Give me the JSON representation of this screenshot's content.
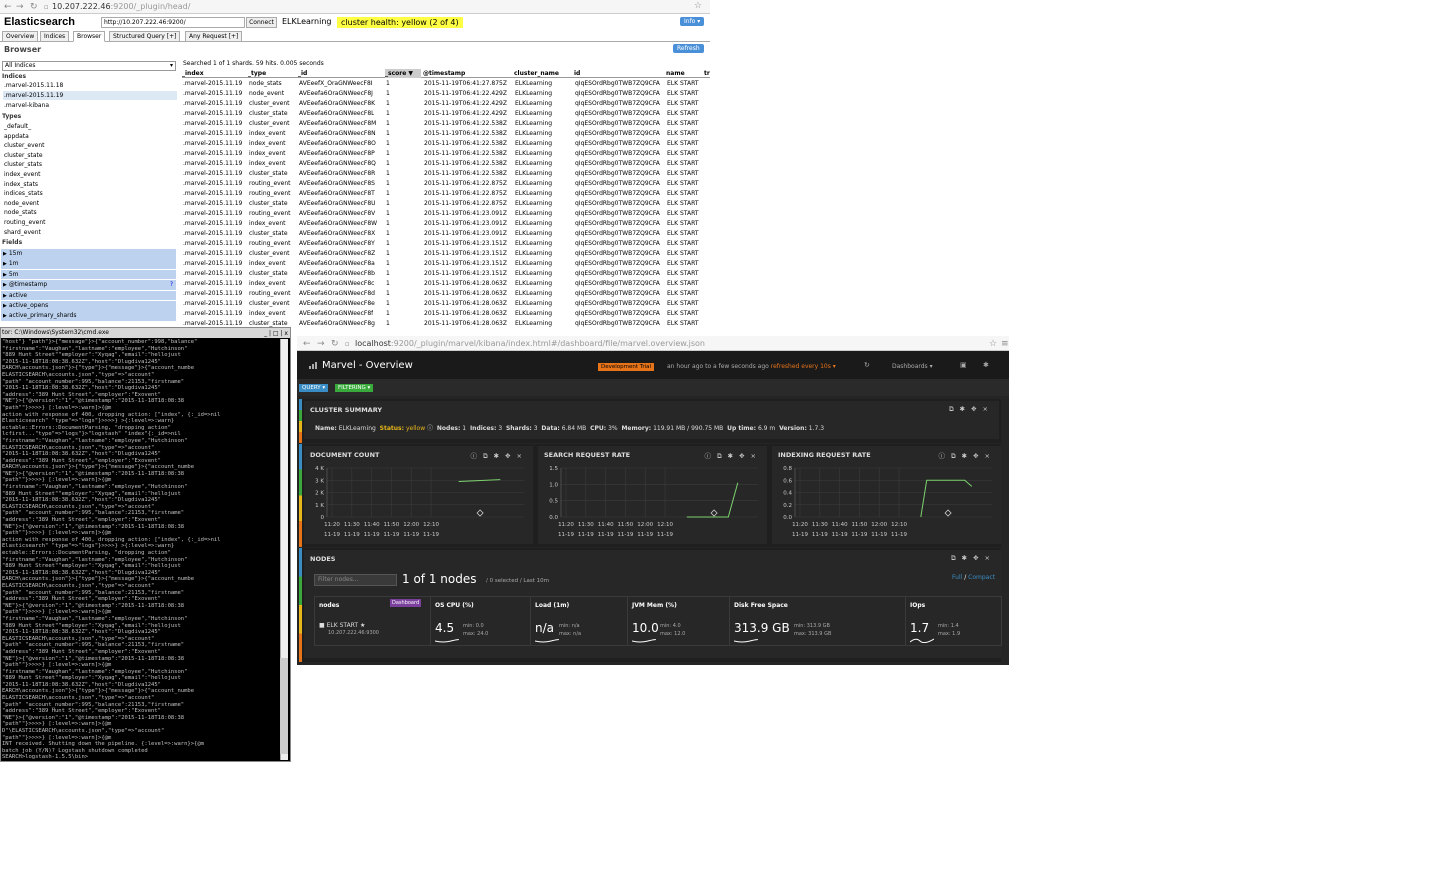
{
  "head_browser": {
    "url_host": "10.207.222.46",
    "url_rest": ":9200/_plugin/head/",
    "app_title": "Elasticsearch",
    "connect_url": "http://10.207.222.46:9200/",
    "connect_label": "Connect",
    "cluster_name": "ELKLearning",
    "cluster_health": "cluster health: yellow (2 of 4)",
    "info_label": "Info ▾",
    "tabs": [
      "Overview",
      "Indices",
      "Browser",
      "Structured Query [+]",
      "Any Request [+]"
    ],
    "section_title": "Browser",
    "refresh_label": "Refresh",
    "index_select": "All Indices",
    "indices_header": "Indices",
    "indices": [
      ".marvel-2015.11.18",
      ".marvel-2015.11.19",
      ".marvel-kibana"
    ],
    "types_header": "Types",
    "types": [
      "_default_",
      "appdata",
      "cluster_event",
      "cluster_state",
      "cluster_stats",
      "index_event",
      "index_stats",
      "indices_stats",
      "node_event",
      "node_stats",
      "routing_event",
      "shard_event"
    ],
    "fields_header": "Fields",
    "fields": [
      "15m",
      "1m",
      "5m",
      "@timestamp",
      "active",
      "active_opens",
      "active_primary_shards"
    ],
    "results_summary": "Searched 1 of 1 shards. 59 hits. 0.005 seconds",
    "columns": [
      "_index",
      "_type",
      "_id",
      "_score ▼",
      "@timestamp",
      "cluster_name",
      "id",
      "name",
      "tr"
    ],
    "rows": [
      [
        ".marvel-2015.11.19",
        "node_stats",
        "AVEeefX_OraGNWeecF8I",
        "1",
        "2015-11-19T06:41:27.875Z",
        "ELKLearning",
        "qIqESOrdRbg0TWB7ZQ9CFA",
        "ELK START"
      ],
      [
        ".marvel-2015.11.19",
        "node_event",
        "AVEeefa6OraGNWeecF8J",
        "1",
        "2015-11-19T06:41:22.429Z",
        "ELKLearning",
        "qIqESOrdRbg0TWB7ZQ9CFA",
        "ELK START"
      ],
      [
        ".marvel-2015.11.19",
        "cluster_event",
        "AVEeefa6OraGNWeecF8K",
        "1",
        "2015-11-19T06:41:22.429Z",
        "ELKLearning",
        "qIqESOrdRbg0TWB7ZQ9CFA",
        "ELK START"
      ],
      [
        ".marvel-2015.11.19",
        "cluster_state",
        "AVEeefa6OraGNWeecF8L",
        "1",
        "2015-11-19T06:41:22.429Z",
        "ELKLearning",
        "qIqESOrdRbg0TWB7ZQ9CFA",
        "ELK START"
      ],
      [
        ".marvel-2015.11.19",
        "cluster_event",
        "AVEeefa6OraGNWeecF8M",
        "1",
        "2015-11-19T06:41:22.538Z",
        "ELKLearning",
        "qIqESOrdRbg0TWB7ZQ9CFA",
        "ELK START"
      ],
      [
        ".marvel-2015.11.19",
        "index_event",
        "AVEeefa6OraGNWeecF8N",
        "1",
        "2015-11-19T06:41:22.538Z",
        "ELKLearning",
        "qIqESOrdRbg0TWB7ZQ9CFA",
        "ELK START"
      ],
      [
        ".marvel-2015.11.19",
        "index_event",
        "AVEeefa6OraGNWeecF8O",
        "1",
        "2015-11-19T06:41:22.538Z",
        "ELKLearning",
        "qIqESOrdRbg0TWB7ZQ9CFA",
        "ELK START"
      ],
      [
        ".marvel-2015.11.19",
        "index_event",
        "AVEeefa6OraGNWeecF8P",
        "1",
        "2015-11-19T06:41:22.538Z",
        "ELKLearning",
        "qIqESOrdRbg0TWB7ZQ9CFA",
        "ELK START"
      ],
      [
        ".marvel-2015.11.19",
        "index_event",
        "AVEeefa6OraGNWeecF8Q",
        "1",
        "2015-11-19T06:41:22.538Z",
        "ELKLearning",
        "qIqESOrdRbg0TWB7ZQ9CFA",
        "ELK START"
      ],
      [
        ".marvel-2015.11.19",
        "cluster_state",
        "AVEeefa6OraGNWeecF8R",
        "1",
        "2015-11-19T06:41:22.538Z",
        "ELKLearning",
        "qIqESOrdRbg0TWB7ZQ9CFA",
        "ELK START"
      ],
      [
        ".marvel-2015.11.19",
        "routing_event",
        "AVEeefa6OraGNWeecF8S",
        "1",
        "2015-11-19T06:41:22.875Z",
        "ELKLearning",
        "qIqESOrdRbg0TWB7ZQ9CFA",
        "ELK START"
      ],
      [
        ".marvel-2015.11.19",
        "routing_event",
        "AVEeefa6OraGNWeecF8T",
        "1",
        "2015-11-19T06:41:22.875Z",
        "ELKLearning",
        "qIqESOrdRbg0TWB7ZQ9CFA",
        "ELK START"
      ],
      [
        ".marvel-2015.11.19",
        "cluster_state",
        "AVEeefa6OraGNWeecF8U",
        "1",
        "2015-11-19T06:41:22.875Z",
        "ELKLearning",
        "qIqESOrdRbg0TWB7ZQ9CFA",
        "ELK START"
      ],
      [
        ".marvel-2015.11.19",
        "routing_event",
        "AVEeefa6OraGNWeecF8V",
        "1",
        "2015-11-19T06:41:23.091Z",
        "ELKLearning",
        "qIqESOrdRbg0TWB7ZQ9CFA",
        "ELK START"
      ],
      [
        ".marvel-2015.11.19",
        "index_event",
        "AVEeefa6OraGNWeecF8W",
        "1",
        "2015-11-19T06:41:23.091Z",
        "ELKLearning",
        "qIqESOrdRbg0TWB7ZQ9CFA",
        "ELK START"
      ],
      [
        ".marvel-2015.11.19",
        "cluster_state",
        "AVEeefa6OraGNWeecF8X",
        "1",
        "2015-11-19T06:41:23.091Z",
        "ELKLearning",
        "qIqESOrdRbg0TWB7ZQ9CFA",
        "ELK START"
      ],
      [
        ".marvel-2015.11.19",
        "routing_event",
        "AVEeefa6OraGNWeecF8Y",
        "1",
        "2015-11-19T06:41:23.151Z",
        "ELKLearning",
        "qIqESOrdRbg0TWB7ZQ9CFA",
        "ELK START"
      ],
      [
        ".marvel-2015.11.19",
        "cluster_event",
        "AVEeefa6OraGNWeecF8Z",
        "1",
        "2015-11-19T06:41:23.151Z",
        "ELKLearning",
        "qIqESOrdRbg0TWB7ZQ9CFA",
        "ELK START"
      ],
      [
        ".marvel-2015.11.19",
        "index_event",
        "AVEeefa6OraGNWeecF8a",
        "1",
        "2015-11-19T06:41:23.151Z",
        "ELKLearning",
        "qIqESOrdRbg0TWB7ZQ9CFA",
        "ELK START"
      ],
      [
        ".marvel-2015.11.19",
        "cluster_state",
        "AVEeefa6OraGNWeecF8b",
        "1",
        "2015-11-19T06:41:23.151Z",
        "ELKLearning",
        "qIqESOrdRbg0TWB7ZQ9CFA",
        "ELK START"
      ],
      [
        ".marvel-2015.11.19",
        "index_event",
        "AVEeefa6OraGNWeecF8c",
        "1",
        "2015-11-19T06:41:28.063Z",
        "ELKLearning",
        "qIqESOrdRbg0TWB7ZQ9CFA",
        "ELK START"
      ],
      [
        ".marvel-2015.11.19",
        "routing_event",
        "AVEeefa6OraGNWeecF8d",
        "1",
        "2015-11-19T06:41:28.063Z",
        "ELKLearning",
        "qIqESOrdRbg0TWB7ZQ9CFA",
        "ELK START"
      ],
      [
        ".marvel-2015.11.19",
        "cluster_event",
        "AVEeefa6OraGNWeecF8e",
        "1",
        "2015-11-19T06:41:28.063Z",
        "ELKLearning",
        "qIqESOrdRbg0TWB7ZQ9CFA",
        "ELK START"
      ],
      [
        ".marvel-2015.11.19",
        "index_event",
        "AVEeefa6OraGNWeecF8f",
        "1",
        "2015-11-19T06:41:28.063Z",
        "ELKLearning",
        "qIqESOrdRbg0TWB7ZQ9CFA",
        "ELK START"
      ],
      [
        ".marvel-2015.11.19",
        "cluster_state",
        "AVEeefa6OraGNWeecF8g",
        "1",
        "2015-11-19T06:41:28.063Z",
        "ELKLearning",
        "qIqESOrdRbg0TWB7ZQ9CFA",
        "ELK START"
      ]
    ]
  },
  "cmd": {
    "title": "tor: C:\\Windows\\System32\\cmd.exe",
    "buttons": "_ | □ | x",
    "lines": [
      "\"host\"} \"path\"}>{\"message\"}>{\"account_number\":998,\"balance\"",
      "\"firstname\":\"Vaughan\",\"lastname\":\"employee\",\"Hutchinson\"",
      "\"889 Hunt Street\"\"employer\":\"Xyqag\",\"email\":\"hellojust",
      "\"2015-11-18T18:08:38.632Z\",\"host\":\"Dlugdiva1245\"",
      "EARCH\\accounts.json\"}>{\"type\"}>{\"message\"}>{\"account_numbe",
      "ELASTICSEARCH\\accounts.json\",\"type\"=>\"account\"",
      "\"path\" \"account_number\":995,\"balance\":21153,\"firstname\"",
      "\"2015-11-18T18:08:38.632Z\",\"host\":\"Dlugdiva1245\"",
      "\"address\":\"389 Hunt Street\",\"employer\":\"Exovent\"",
      "\"NE\"}>{\"@version\":\"1\",\"@timestamp\":\"2015-11-18T18:08:38",
      "\"path\"\"}>>>>} [:level=>:warn]>{@m",
      "",
      "action with response of 400, dropping action: [\"index\", {:_id=>nil",
      "Elasticsearch\" \"type\"=>\"logs\"}>>>>} >{:level=>:warn}",
      "ectable::Errors::DocumentParsing, \"dropping action\"",
      "lcfirst...\"type\"=>\"logs\"}>\"logstash\" \"index\"{:_id=>nil",
      "\"firstname\":\"Vaughan\",\"lastname\":\"employee\",\"Hutchinson\"",
      "ELASTICSEARCH\\accounts.json\",\"type\"=>\"account\"",
      "\"2015-11-18T18:08:38.632Z\",\"host\":\"Dlugdiva1245\"",
      "\"address\":\"389 Hunt Street\",\"employer\":\"Exovent\"",
      "EARCH\\accounts.json\"}>{\"type\"}>{\"message\"}>{\"account_numbe",
      "\"NE\"}>{\"@version\":\"1\",\"@timestamp\":\"2015-11-18T18:08:38",
      "\"path\"\"}>>>>} [:level=>:warn]>{@m",
      "\"firstname\":\"Vaughan\",\"lastname\":\"employee\",\"Hutchinson\"",
      "\"889 Hunt Street\"\"employer\":\"Xyqag\",\"email\":\"hellojust",
      "\"2015-11-18T18:08:38.632Z\",\"host\":\"Dlugdiva1245\"",
      "ELASTICSEARCH\\accounts.json\",\"type\"=>\"account\"",
      "\"path\" \"account_number\":995,\"balance\":21153,\"firstname\"",
      "\"address\":\"389 Hunt Street\",\"employer\":\"Exovent\"",
      "\"NE\"}>{\"@version\":\"1\",\"@timestamp\":\"2015-11-18T18:08:38",
      "\"path\"\"}>>>>} [:level=>:warn]>{@m",
      "action with response of 400, dropping action: [\"index\", {:_id=>nil",
      "Elasticsearch\" \"type\"=>\"logs\"}>>>>} >{:level=>:warn}",
      "ectable::Errors::DocumentParsing, \"dropping action\"",
      "\"firstname\":\"Vaughan\",\"lastname\":\"employee\",\"Hutchinson\"",
      "\"889 Hunt Street\"\"employer\":\"Xyqag\",\"email\":\"hellojust",
      "\"2015-11-18T18:08:38.632Z\",\"host\":\"Dlugdiva1245\"",
      "EARCH\\accounts.json\"}>{\"type\"}>{\"message\"}>{\"account_numbe",
      "ELASTICSEARCH\\accounts.json\",\"type\"=>\"account\"",
      "\"path\" \"account_number\":995,\"balance\":21153,\"firstname\"",
      "\"address\":\"389 Hunt Street\",\"employer\":\"Exovent\"",
      "\"NE\"}>{\"@version\":\"1\",\"@timestamp\":\"2015-11-18T18:08:38",
      "\"path\"\"}>>>>} [:level=>:warn]>{@m",
      "\"firstname\":\"Vaughan\",\"lastname\":\"employee\",\"Hutchinson\"",
      "\"889 Hunt Street\"\"employer\":\"Xyqag\",\"email\":\"hellojust",
      "\"2015-11-18T18:08:38.632Z\",\"host\":\"Dlugdiva1245\"",
      "ELASTICSEARCH\\accounts.json\",\"type\"=>\"account\"",
      "\"path\" \"account_number\":995,\"balance\":21153,\"firstname\"",
      "\"address\":\"389 Hunt Street\",\"employer\":\"Exovent\"",
      "\"NE\"}>{\"@version\":\"1\",\"@timestamp\":\"2015-11-18T18:08:38",
      "\"path\"\"}>>>>} [:level=>:warn]>{@m",
      "\"firstname\":\"Vaughan\",\"lastname\":\"employee\",\"Hutchinson\"",
      "\"889 Hunt Street\"\"employer\":\"Xyqag\",\"email\":\"hellojust",
      "\"2015-11-18T18:08:38.632Z\",\"host\":\"Dlugdiva1245\"",
      "EARCH\\accounts.json\"}>{\"type\"}>{\"message\"}>{\"account_numbe",
      "ELASTICSEARCH\\accounts.json\",\"type\"=>\"account\"",
      "\"path\" \"account_number\":995,\"balance\":21153,\"firstname\"",
      "\"address\":\"389 Hunt Street\",\"employer\":\"Exovent\"",
      "\"NE\"}>{\"@version\":\"1\",\"@timestamp\":\"2015-11-18T18:08:38",
      "\"path\"\"}>>>>} [:level=>:warn]>{@m",
      "D\"\\ELASTICSEARCH\\accounts.json\",\"type\"=>\"account\"",
      "\"path\"\"}>>>>} [:level=>:warn]>{@m",
      "INT received. Shutting down the pipeline. {:level=>:warn}>{@m",
      "batch job (Y/N)? Logstash shutdown completed",
      "",
      "SEARCH>logstash-1.5.5\\bin>"
    ]
  },
  "marvel": {
    "url_host": "localhost",
    "url_rest": ":9200/_plugin/marvel/kibana/index.html#/dashboard/file/marvel.overview.json",
    "title": "Marvel - Overview",
    "trial_label": "Development Trial",
    "time_range": "an hour ago to a few seconds ago",
    "refresh_text": "refreshed every 10s ▾",
    "dashboards_label": "Dashboards ▾",
    "query_label": "QUERY ▾",
    "filtering_label": "FILTERING ▾",
    "cluster_summary": {
      "title": "CLUSTER SUMMARY",
      "name_label": "Name:",
      "name": "ELKLearning",
      "status_label": "Status:",
      "status": "yellow",
      "nodes_label": "Nodes:",
      "nodes": "1",
      "indices_label": "Indices:",
      "indices": "3",
      "shards_label": "Shards:",
      "shards": "3",
      "data_label": "Data:",
      "data": "6.84 MB",
      "cpu_label": "CPU:",
      "cpu": "3%",
      "memory_label": "Memory:",
      "memory": "119.91 MB / 990.75 MB",
      "uptime_label": "Up time:",
      "uptime": "6.9 m",
      "version_label": "Version:",
      "version": "1.7.3",
      "status_color": "#e8b71a"
    },
    "charts_titles": [
      "DOCUMENT COUNT",
      "SEARCH REQUEST RATE",
      "INDEXING REQUEST RATE"
    ],
    "nodes_panel": {
      "title": "NODES",
      "filter_placeholder": "Filter nodes...",
      "count": "1 of 1 nodes",
      "sub": "/ 0 selected / Last 10m",
      "full": "Full",
      "sep": "/",
      "compact": "Compact",
      "col_nodes": "nodes",
      "dashboard_btn": "Dashboard",
      "node_name": "ELK START",
      "node_ip": "10.207.222.46:9300",
      "metrics": [
        {
          "header": "OS CPU (%)",
          "value": "4.5",
          "min": "min: 0.0",
          "max": "max: 24.0"
        },
        {
          "header": "Load (1m)",
          "value": "n/a",
          "min": "min: n/a",
          "max": "max: n/a"
        },
        {
          "header": "JVM Mem (%)",
          "value": "10.0",
          "min": "min: 4.0",
          "max": "max: 12.0"
        },
        {
          "header": "Disk Free Space",
          "value": "313.9 GB",
          "min": "min: 313.9 GB",
          "max": "max: 313.9 GB"
        },
        {
          "header": "IOps",
          "value": "1.7",
          "min": "min: 1.4",
          "max": "max: 1.9"
        }
      ]
    }
  },
  "chart_data": [
    {
      "type": "line",
      "title": "DOCUMENT COUNT",
      "x": [
        "11:20\n11-19",
        "11:30\n11-19",
        "11:40\n11-19",
        "11:50\n11-19",
        "12:00\n11-19",
        "12:10\n11-19"
      ],
      "yticks": [
        "4 K",
        "3 K",
        "2 K",
        "1 K",
        "0"
      ],
      "ylim": [
        0,
        4000
      ],
      "series": [
        {
          "points": [
            [
              12.4,
              2900
            ],
            [
              12.75,
              3050
            ]
          ]
        }
      ],
      "grid": true
    },
    {
      "type": "line",
      "title": "SEARCH REQUEST RATE",
      "x": [
        "11:20\n11-19",
        "11:30\n11-19",
        "11:40\n11-19",
        "11:50\n11-19",
        "12:00\n11-19",
        "12:10\n11-19"
      ],
      "yticks": [
        "1.5",
        "1.0",
        "0.5",
        "0.0"
      ],
      "ylim": [
        0,
        1.5
      ],
      "series": [
        {
          "points": [
            [
              12.35,
              0
            ],
            [
              12.7,
              0
            ],
            [
              12.78,
              1.05
            ]
          ]
        }
      ],
      "grid": true
    },
    {
      "type": "line",
      "title": "INDEXING REQUEST RATE",
      "x": [
        "11:20\n11-19",
        "11:30\n11-19",
        "11:40\n11-19",
        "11:50\n11-19",
        "12:00\n11-19",
        "12:10\n11-19"
      ],
      "yticks": [
        "0.8",
        "0.6",
        "0.4",
        "0.2",
        "0.0"
      ],
      "ylim": [
        0,
        0.8
      ],
      "series": [
        {
          "points": [
            [
              12.35,
              0
            ],
            [
              12.4,
              0.6
            ],
            [
              12.72,
              0.6
            ],
            [
              12.78,
              0.5
            ]
          ]
        }
      ],
      "grid": true
    }
  ]
}
